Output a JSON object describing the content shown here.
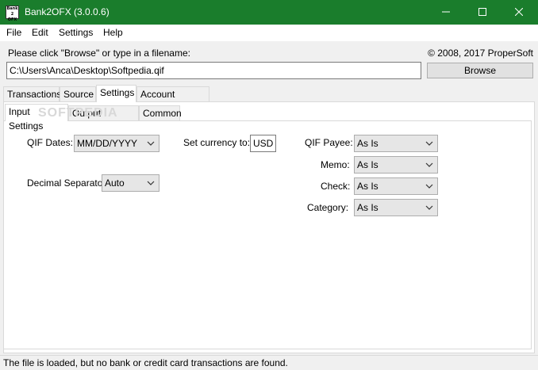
{
  "window": {
    "title": "Bank2OFX (3.0.0.6)",
    "icon_lines": [
      "Bank",
      "2",
      "OFX"
    ],
    "title_bar_color": "#1a7d2c"
  },
  "menu": [
    "File",
    "Edit",
    "Settings",
    "Help"
  ],
  "file_prompt": "Please click \"Browse\" or type in a filename:",
  "copyright": "© 2008, 2017 ProperSoft",
  "filename_value": "C:\\Users\\Anca\\Desktop\\Softpedia.qif",
  "browse_label": "Browse",
  "main_tabs": [
    "Transactions",
    "Source",
    "Settings",
    "Account Mapping"
  ],
  "active_main_tab": "Settings",
  "sub_tabs": [
    "Input Settings",
    "Output Settings",
    "Common"
  ],
  "active_sub_tab": "Input Settings",
  "watermark": "SOFTPEDIA",
  "input_settings": {
    "qif_dates_label": "QIF Dates:",
    "qif_dates_value": "MM/DD/YYYY",
    "currency_label": "Set currency to:",
    "currency_value": "USD",
    "decimal_label": "Decimal Separator:",
    "decimal_value": "Auto",
    "payee_label": "QIF Payee:",
    "payee_value": "As Is",
    "memo_label": "Memo:",
    "memo_value": "As Is",
    "check_label": "Check:",
    "check_value": "As Is",
    "category_label": "Category:",
    "category_value": "As Is"
  },
  "status": "The file is loaded, but no bank or credit card transactions are found.",
  "icons": {
    "minimize": "minimize-icon",
    "maximize": "maximize-icon",
    "close": "close-icon",
    "dropdown": "chevron-down-icon"
  }
}
